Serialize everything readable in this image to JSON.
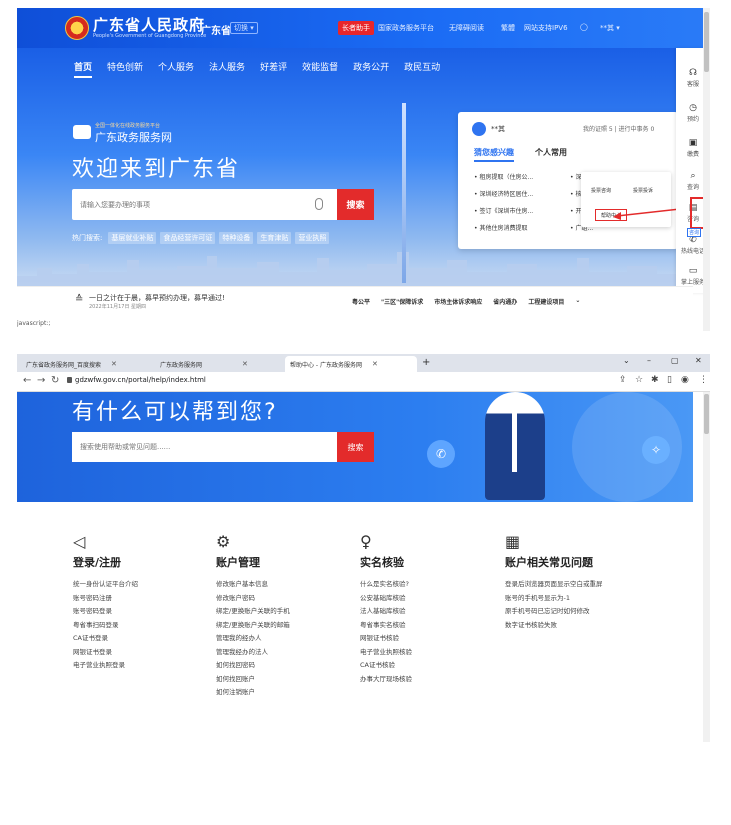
{
  "top": {
    "header": {
      "logo_cn": "广东省人民政府",
      "logo_en": "People's Government of Guangdong Province",
      "region": "广东省",
      "switch": "切换 ▾",
      "assistant": "长者助手",
      "links": [
        "国家政务服务平台",
        "无障碍阅读",
        "繁體",
        "网站支持IPV6",
        "◯",
        "**其 ▾"
      ]
    },
    "nav": [
      "首页",
      "特色创新",
      "个人服务",
      "法人服务",
      "好差评",
      "效能监督",
      "政务公开",
      "政民互动"
    ],
    "hero": {
      "service_small": "全国一体化在线政务服务平台",
      "service_name": "广东政务服务网",
      "welcome": "欢迎来到广东省",
      "search_placeholder": "请输入您要办理的事项",
      "search_button": "搜索",
      "hot_label": "热门搜索:",
      "hot_tags": [
        "基层就业补贴",
        "食品经营许可证",
        "特种设备",
        "生育津贴",
        "营业执照"
      ]
    },
    "card": {
      "username": "**其",
      "my_cert": "我的证照 5  |  进行中事务 0",
      "tab_guess": "猜您感兴趣",
      "tab_personal": "个人常用",
      "items": [
        "租房提取（住房公...",
        "深圳经济特区居住...",
        "签订《深圳市住房...",
        "其他住房消费提取"
      ],
      "items_right": [
        "深圳...",
        "核发...",
        "开具...",
        "广组..."
      ],
      "popup": {
        "btn1": "投票咨询",
        "btn2": "投票投诉",
        "help": "帮助中心"
      }
    },
    "sidebar": [
      {
        "icon": "☊",
        "label": "客服"
      },
      {
        "icon": "◷",
        "label": "预约"
      },
      {
        "icon": "▣",
        "label": "缴费"
      },
      {
        "icon": "⌕",
        "label": "查询"
      },
      {
        "icon": "▤",
        "label": "咨询"
      },
      {
        "icon": "✆",
        "label": "热线电话"
      },
      {
        "icon": "▭",
        "label": "掌上服务"
      }
    ],
    "tooltip": "咨询",
    "notice": {
      "icon": "≙",
      "text": "一日之计在于晨，募早预约办理，募早通过!",
      "date": "2022年11月17日 星期四",
      "shortcuts": [
        "粤公平",
        "\"三区\"保障诉求",
        "市场主体诉求响应",
        "省内通办",
        "工程建设项目",
        "⌄"
      ]
    },
    "statusbar": "javascript:;"
  },
  "bottom": {
    "tabs": [
      {
        "label": "广东省政务服务网_百度搜索"
      },
      {
        "label": "广东政务服务网"
      },
      {
        "label": "帮助中心 - 广东政务服务网"
      }
    ],
    "url": "gdzwfw.gov.cn/portal/help/index.html",
    "banner_title": "有什么可以帮到您?",
    "search_placeholder": "搜索使用帮助或常见问题......",
    "search_button": "搜索",
    "columns": [
      {
        "icon": "◁",
        "title": "登录/注册",
        "items": [
          "统一身份认证平台介绍",
          "账号密码注册",
          "账号密码登录",
          "粤省事扫码登录",
          "CA证书登录",
          "网银证书登录",
          "电子营业执照登录"
        ]
      },
      {
        "icon": "⚙",
        "title": "账户管理",
        "items": [
          "修改账户基本信息",
          "修改账户密码",
          "绑定/更换账户关联的手机",
          "绑定/更换账户关联的邮箱",
          "管理我的经办人",
          "管理我经办的法人",
          "如何找回密码",
          "如何找回账户",
          "如何注销账户"
        ]
      },
      {
        "icon": "♀",
        "title": "实名核验",
        "items": [
          "什么是实名核验?",
          "公安基础库核验",
          "法人基础库核验",
          "粤省事实名核验",
          "网银证书核验",
          "电子营业执照核验",
          "CA证书核验",
          "办事大厅现场核验"
        ]
      },
      {
        "icon": "▦",
        "title": "账户相关常见问题",
        "items": [
          "登录后浏览器页面显示空白或重屏",
          "账号的手机号显示为-1",
          "原手机号码已忘记时如何修改",
          "数字证书核验失败"
        ]
      }
    ]
  }
}
